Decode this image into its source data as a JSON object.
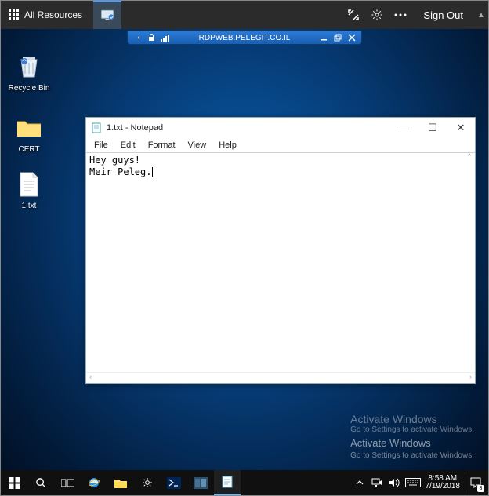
{
  "topbar": {
    "all_resources": "All Resources",
    "sign_out": "Sign Out"
  },
  "connbar": {
    "host": "RDPWEB.PELEGIT.CO.IL"
  },
  "desktop": {
    "recycle": "Recycle Bin",
    "cert": "CERT",
    "txt": "1.txt"
  },
  "notepad": {
    "title": "1.txt - Notepad",
    "menu": {
      "file": "File",
      "edit": "Edit",
      "format": "Format",
      "view": "View",
      "help": "Help"
    },
    "lines": {
      "l1": "Hey guys!",
      "l2": "Meir Peleg."
    }
  },
  "watermark": {
    "title": "Activate Windows",
    "sub": "Go to Settings to activate Windows."
  },
  "tray": {
    "time": "8:58 AM",
    "date": "7/19/2018",
    "notif_count": "3"
  }
}
